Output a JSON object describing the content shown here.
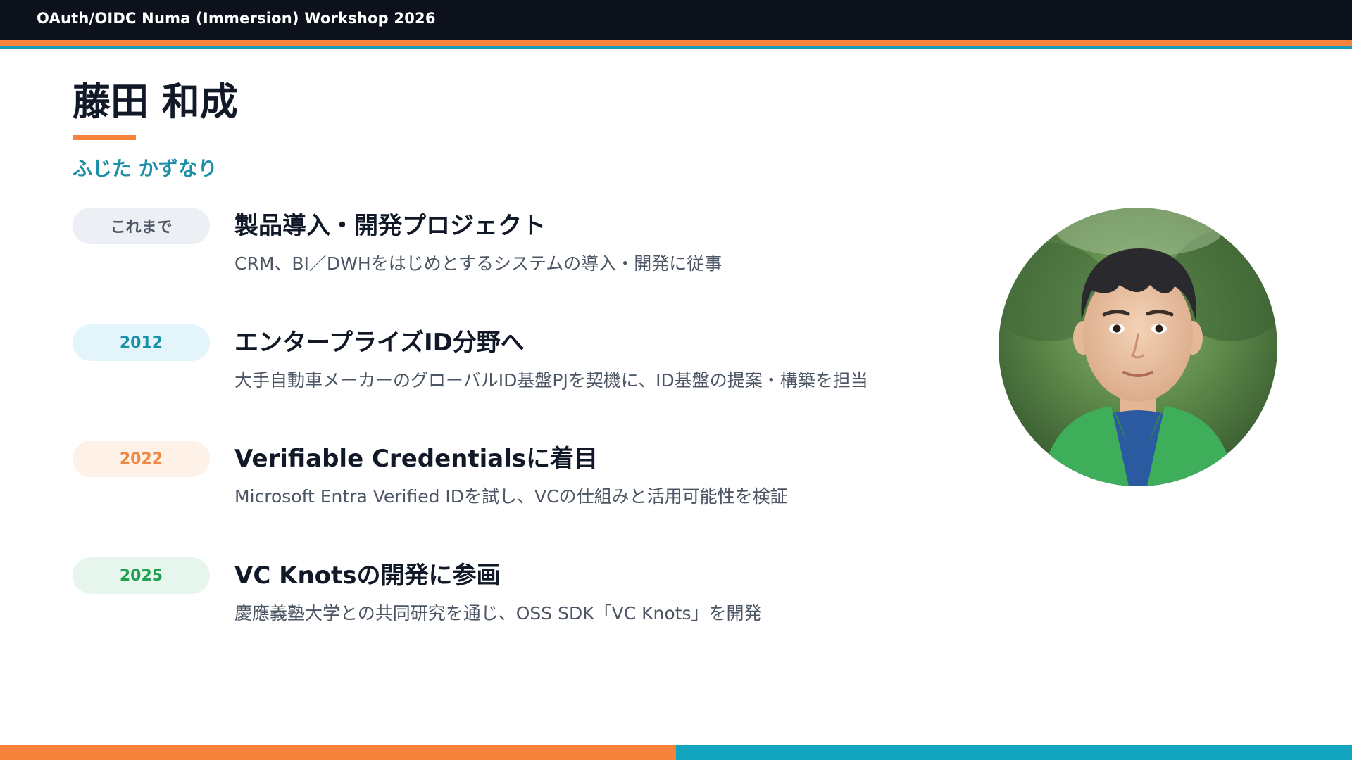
{
  "header": {
    "title": "OAuth/OIDC Numa (Immersion) Workshop 2026"
  },
  "profile": {
    "name": "藤田 和成",
    "furigana": "ふじた かずなり"
  },
  "colors": {
    "accent_orange": "#f5833b",
    "accent_teal": "#1a9bb6",
    "header_bg": "#0d111b"
  },
  "timeline": [
    {
      "badge": "これまで",
      "badge_bg": "#eceff3",
      "badge_color": "#4b5563",
      "heading": "製品導入・開発プロジェクト",
      "description": "CRM、BI／DWHをはじめとするシステムの導入・開発に従事"
    },
    {
      "badge": "2012",
      "badge_bg": "#e3f5fa",
      "badge_color": "#1b8ea8",
      "heading": "エンタープライズID分野へ",
      "description": "大手自動車メーカーのグローバルID基盤PJを契機に、ID基盤の提案・構築を担当"
    },
    {
      "badge": "2022",
      "badge_bg": "#fdf1e8",
      "badge_color": "#ec8a45",
      "heading": "Verifiable Credentialsに着目",
      "description": "Microsoft Entra Verified IDを試し、VCの仕組みと活用可能性を検証"
    },
    {
      "badge": "2025",
      "badge_bg": "#e7f6ec",
      "badge_color": "#22a053",
      "heading": "VC Knotsの開発に参画",
      "description": "慶應義塾大学との共同研究を通じ、OSS SDK「VC Knots」を開発"
    }
  ],
  "portrait": {
    "icon": "person-avatar-illustration"
  }
}
